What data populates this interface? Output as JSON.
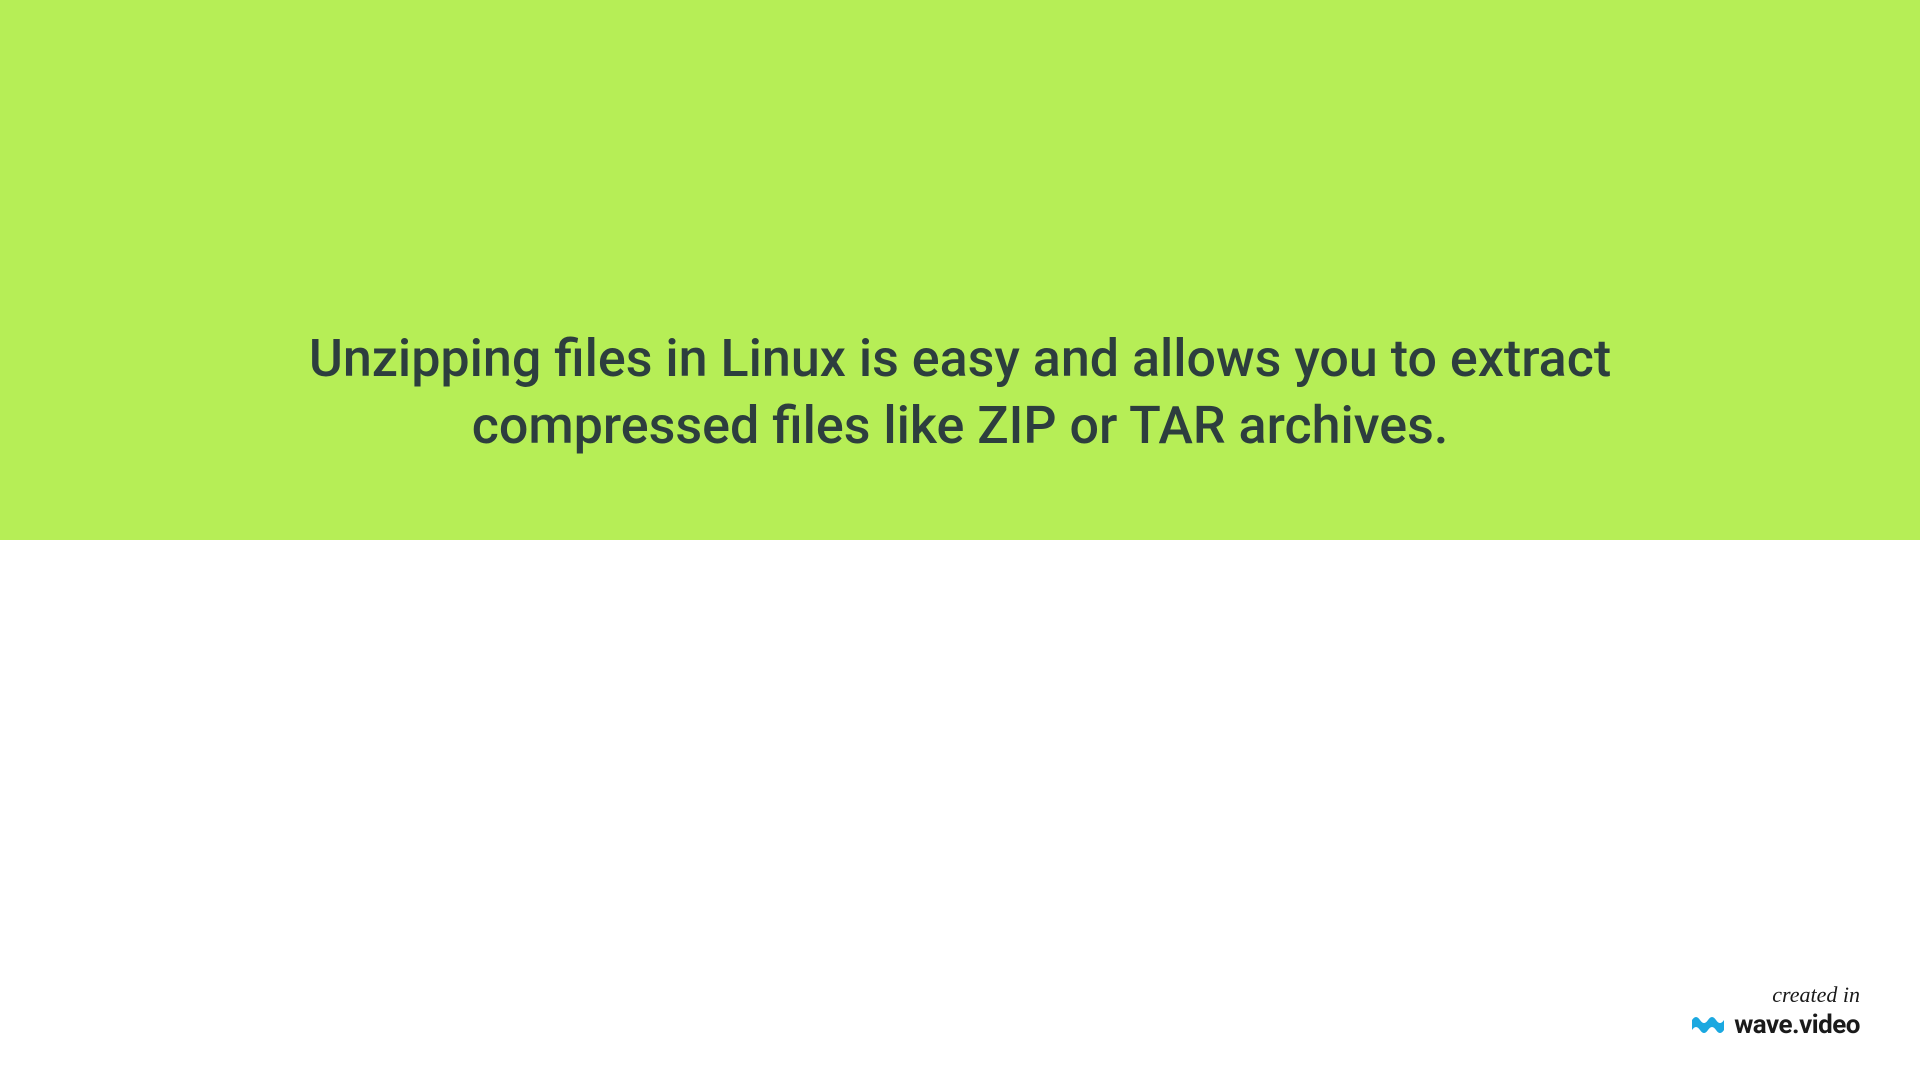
{
  "banner": {
    "text": "Unzipping files in Linux is easy and allows you to extract compressed files like ZIP or TAR archives."
  },
  "watermark": {
    "created_label": "created in",
    "brand_name": "wave.video"
  },
  "colors": {
    "banner_bg": "#b6ee56",
    "text_color": "#2d3e3e",
    "wave_icon_color": "#1ba8e0"
  }
}
